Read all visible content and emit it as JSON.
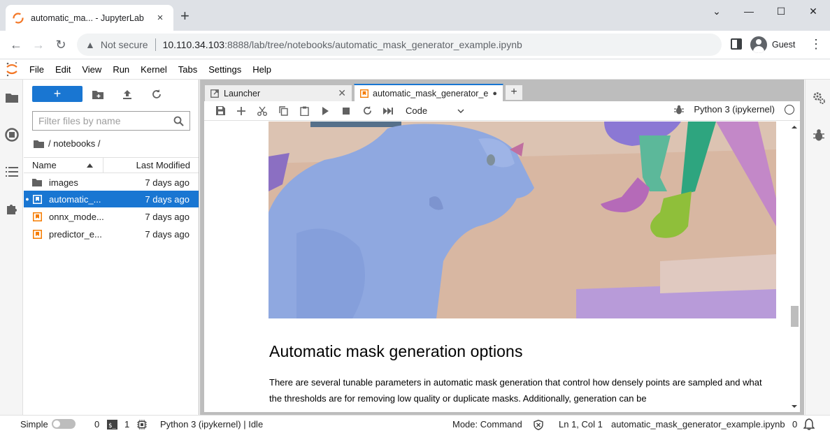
{
  "browser": {
    "tab_title": "automatic_ma... - JupyterLab",
    "close_glyph": "×",
    "new_tab_glyph": "+",
    "not_secure": "Not secure",
    "url_host": "10.110.34.103",
    "url_path": ":8888/lab/tree/notebooks/automatic_mask_generator_example.ipynb",
    "profile_name": "Guest"
  },
  "menu": [
    "File",
    "Edit",
    "View",
    "Run",
    "Kernel",
    "Tabs",
    "Settings",
    "Help"
  ],
  "filebrowser": {
    "new_button_label": "+",
    "filter_placeholder": "Filter files by name",
    "breadcrumb": "/ notebooks /",
    "col_name": "Name",
    "col_modified": "Last Modified",
    "files": [
      {
        "name": "images",
        "modified": "7 days ago",
        "type": "folder"
      },
      {
        "name": "automatic_...",
        "modified": "7 days ago",
        "type": "notebook"
      },
      {
        "name": "onnx_mode...",
        "modified": "7 days ago",
        "type": "notebook"
      },
      {
        "name": "predictor_e...",
        "modified": "7 days ago",
        "type": "notebook"
      }
    ]
  },
  "tabs": {
    "launcher": "Launcher",
    "notebook": "automatic_mask_generator_e",
    "add": "+"
  },
  "toolbar": {
    "cell_type": "Code",
    "kernel_name": "Python 3 (ipykernel)"
  },
  "notebook": {
    "heading": "Automatic mask generation options",
    "paragraph": "There are several tunable parameters in automatic mask generation that control how densely points are sampled and what the thresholds are for removing low quality or duplicate masks. Additionally, generation can be"
  },
  "status": {
    "simple_label": "Simple",
    "terminals_count": "0",
    "kernels_count": "1",
    "kernel_status": "Python 3 (ipykernel) | Idle",
    "mode": "Mode: Command",
    "cursor_pos": "Ln 1, Col 1",
    "filename": "automatic_mask_generator_example.ipynb",
    "notifications": "0"
  },
  "colors": {
    "accent": "#1976d2",
    "notebook_icon": "#f57c00",
    "dog_mask": "#8fa8e0",
    "leg_mask": "#5cb89a"
  }
}
